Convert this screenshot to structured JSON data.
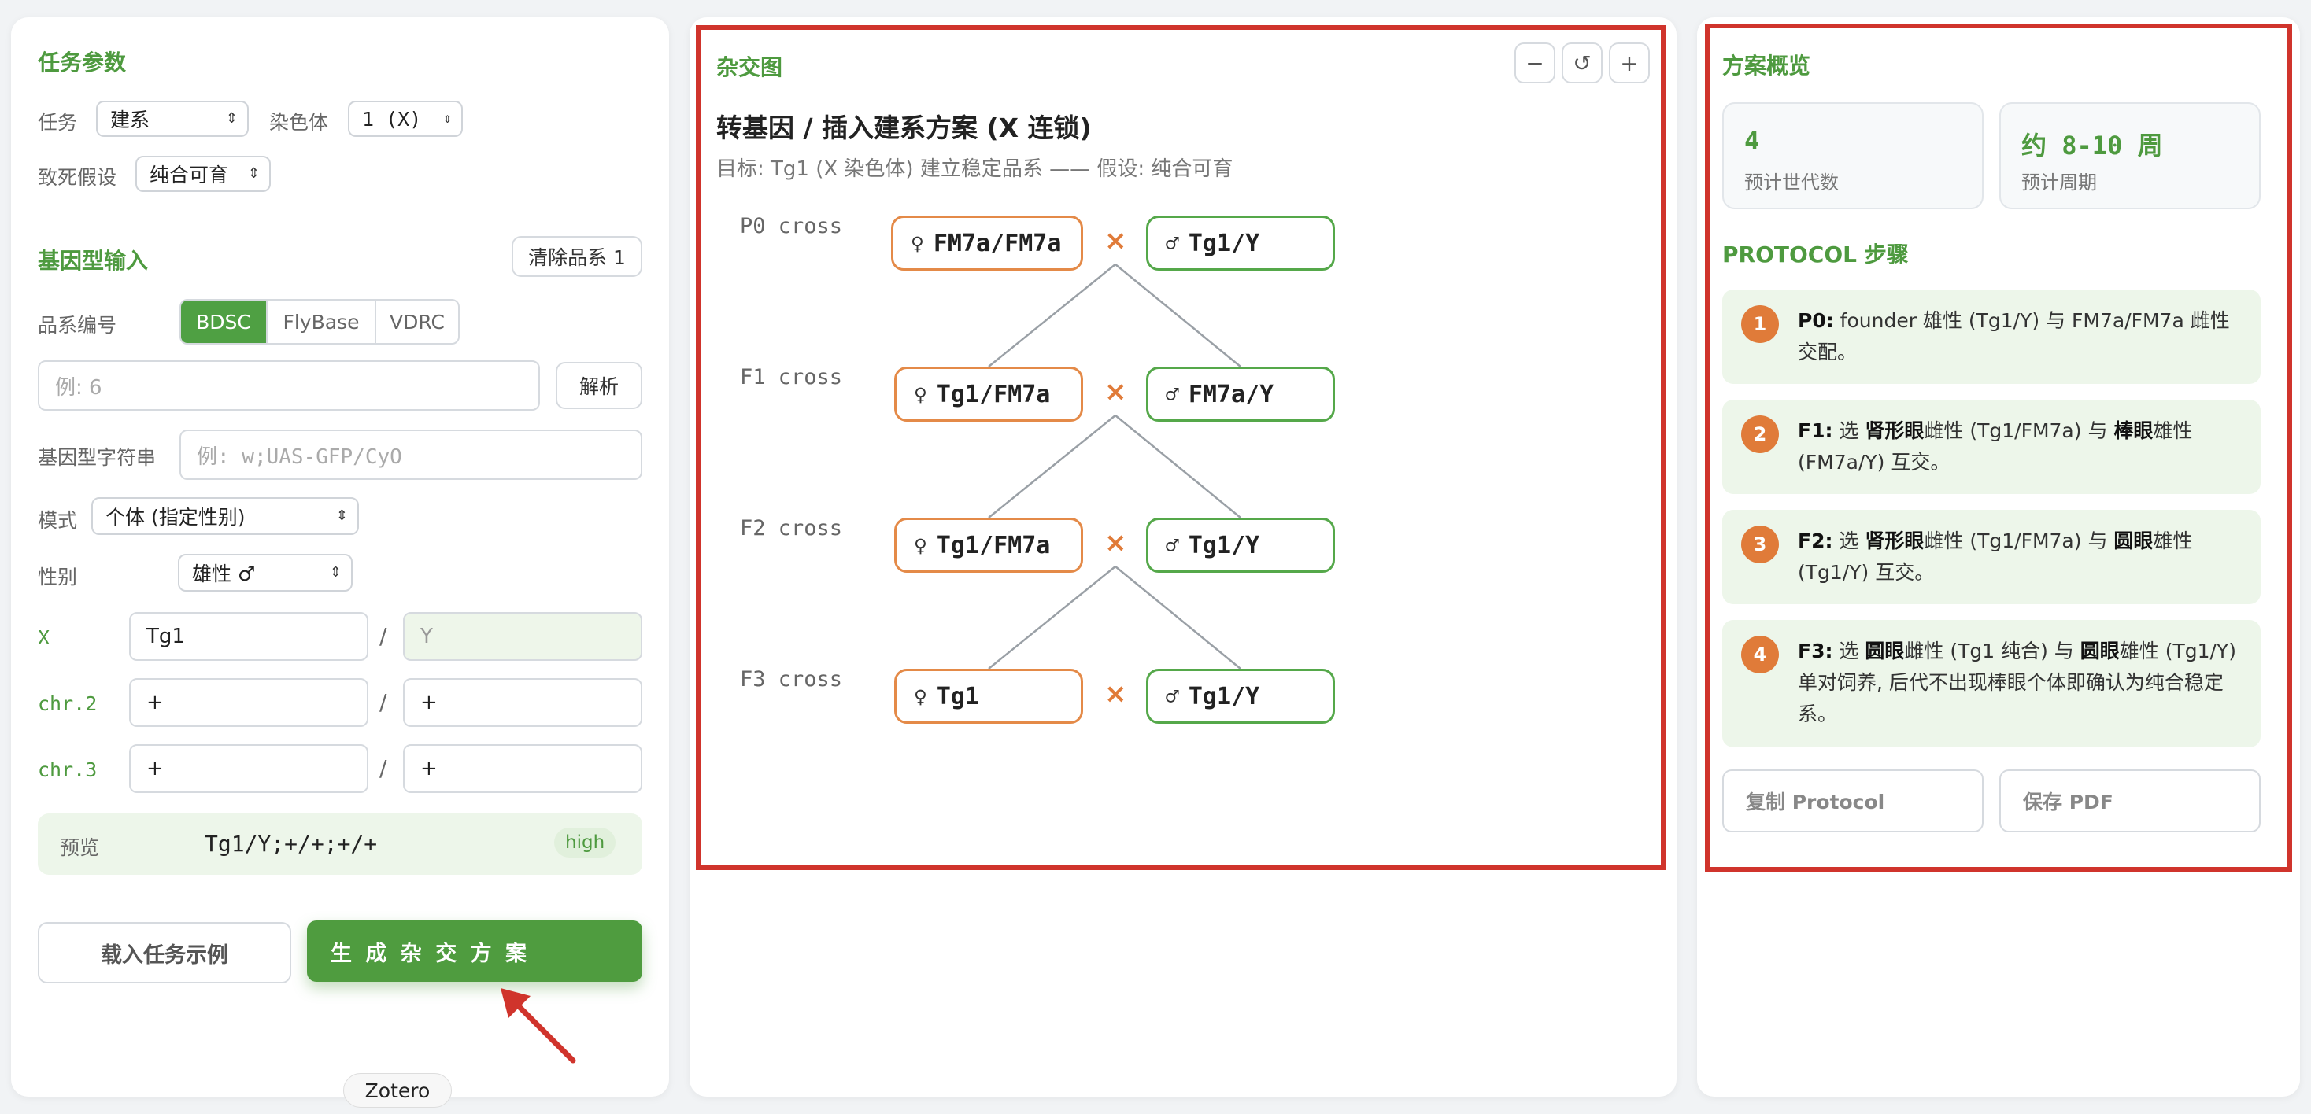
{
  "left": {
    "task_params_title": "任务参数",
    "task_label": "任务",
    "task_value": "建系",
    "chrom_label": "染色体",
    "chrom_value": "1 (X)",
    "lethal_label": "致死假设",
    "lethal_value": "纯合可育",
    "genotype_title": "基因型输入",
    "clear_button": "清除品系 1",
    "stock_label": "品系编号",
    "stock_tabs": [
      "BDSC",
      "FlyBase",
      "VDRC"
    ],
    "stock_placeholder": "例: 6",
    "parse_button": "解析",
    "genotype_string_label": "基因型字符串",
    "genotype_string_placeholder": "例: w;UAS-GFP/CyO",
    "mode_label": "模式",
    "mode_value": "个体 (指定性别)",
    "sex_label": "性别",
    "sex_value": "雄性 ♂",
    "chromosomes": [
      {
        "label": "X",
        "a": "Tg1",
        "b": "Y"
      },
      {
        "label": "chr.2",
        "a": "+",
        "b": "+"
      },
      {
        "label": "chr.3",
        "a": "+",
        "b": "+"
      }
    ],
    "slash": "/",
    "preview_label": "预览",
    "preview_value": "Tg1/Y;+/+;+/+",
    "preview_badge": "high",
    "load_example_button": "载入任务示例",
    "generate_button": "生 成 杂 交 方 案"
  },
  "center": {
    "panel_title": "杂交图",
    "zoom_out": "−",
    "zoom_reset": "↺",
    "zoom_in": "+",
    "scheme_title": "转基因 / 插入建系方案 (X 连锁)",
    "scheme_subtitle": "目标: Tg1 (X 染色体) 建立稳定品系 —— 假设: 纯合可育",
    "crosses": [
      {
        "label": "P0 cross",
        "female": "FM7a/FM7a",
        "male": "Tg1/Y"
      },
      {
        "label": "F1 cross",
        "female": "Tg1/FM7a",
        "male": "FM7a/Y"
      },
      {
        "label": "F2 cross",
        "female": "Tg1/FM7a",
        "male": "Tg1/Y"
      },
      {
        "label": "F3 cross",
        "female": "Tg1",
        "male": "Tg1/Y"
      }
    ],
    "female_symbol": "♀",
    "male_symbol": "♂",
    "cross_symbol": "×"
  },
  "right": {
    "overview_title": "方案概览",
    "generations_value": "4",
    "generations_caption": "预计世代数",
    "period_value": "约 8-10 周",
    "period_caption": "预计周期",
    "protocol_title": "PROTOCOL 步骤",
    "steps": [
      {
        "num": "1",
        "head": "P0:",
        "text": " founder 雄性 (Tg1/Y) 与 FM7a/FM7a 雌性交配。"
      },
      {
        "num": "2",
        "head": "F1:",
        "t1": " 选 ",
        "k1": "肾形眼",
        "t2": "雌性 (Tg1/FM7a) 与 ",
        "k2": "棒眼",
        "t3": "雄性 (FM7a/Y) 互交。"
      },
      {
        "num": "3",
        "head": "F2:",
        "t1": " 选 ",
        "k1": "肾形眼",
        "t2": "雌性 (Tg1/FM7a) 与 ",
        "k2": "圆眼",
        "t3": "雄性 (Tg1/Y) 互交。"
      },
      {
        "num": "4",
        "head": "F3:",
        "t1": " 选 ",
        "k1": "圆眼",
        "t2": "雌性 (Tg1 纯合) 与 ",
        "k2": "圆眼",
        "t3": "雄性 (Tg1/Y) 单对饲养, 后代不出现棒眼个体即确认为纯合稳定系。"
      }
    ],
    "copy_button": "复制 Protocol",
    "save_button": "保存 PDF"
  },
  "dock_tooltip": "Zotero",
  "colors": {
    "accent_green": "#4e9a3f",
    "female_orange": "#e48a48",
    "male_green": "#55a84a",
    "highlight_red": "#d0342c"
  }
}
